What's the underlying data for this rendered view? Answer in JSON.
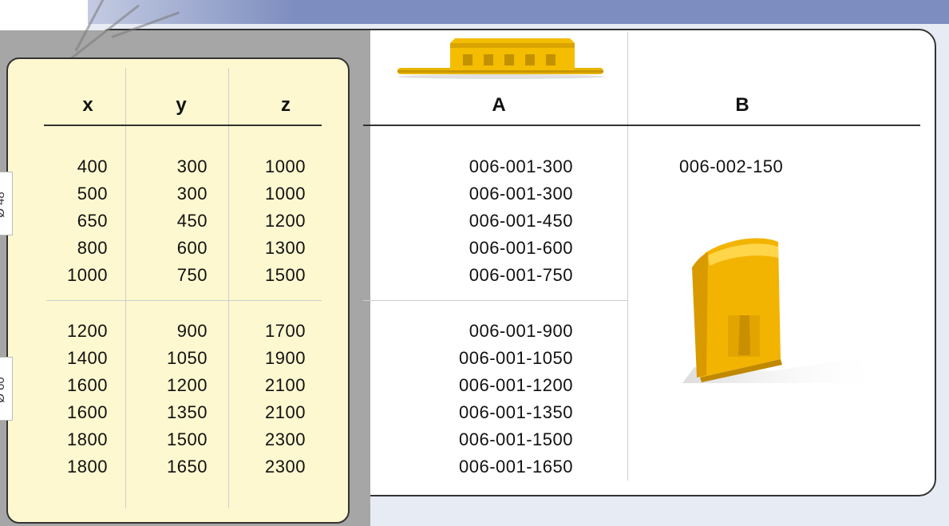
{
  "headers": {
    "x": "x",
    "y": "y",
    "z": "z",
    "a": "A",
    "b": "B"
  },
  "groups": [
    {
      "diameter": "Ø 48",
      "rows": [
        {
          "x": "400",
          "y": "300",
          "z": "1000",
          "a": "006-001-300"
        },
        {
          "x": "500",
          "y": "300",
          "z": "1000",
          "a": "006-001-300"
        },
        {
          "x": "650",
          "y": "450",
          "z": "1200",
          "a": "006-001-450"
        },
        {
          "x": "800",
          "y": "600",
          "z": "1300",
          "a": "006-001-600"
        },
        {
          "x": "1000",
          "y": "750",
          "z": "1500",
          "a": "006-001-750"
        }
      ]
    },
    {
      "diameter": "Ø 60",
      "rows": [
        {
          "x": "1200",
          "y": "900",
          "z": "1700",
          "a": "006-001-900"
        },
        {
          "x": "1400",
          "y": "1050",
          "z": "1900",
          "a": "006-001-1050"
        },
        {
          "x": "1600",
          "y": "1200",
          "z": "2100",
          "a": "006-001-1200"
        },
        {
          "x": "1600",
          "y": "1350",
          "z": "2100",
          "a": "006-001-1350"
        },
        {
          "x": "1800",
          "y": "1500",
          "z": "2300",
          "a": "006-001-1500"
        },
        {
          "x": "1800",
          "y": "1650",
          "z": "2300",
          "a": "006-001-1650"
        }
      ]
    }
  ],
  "b_code": "006-002-150",
  "colors": {
    "accent_yellow": "#f2b900",
    "header_band": "#7d8dbf",
    "left_panel": "#fdf8cf"
  }
}
